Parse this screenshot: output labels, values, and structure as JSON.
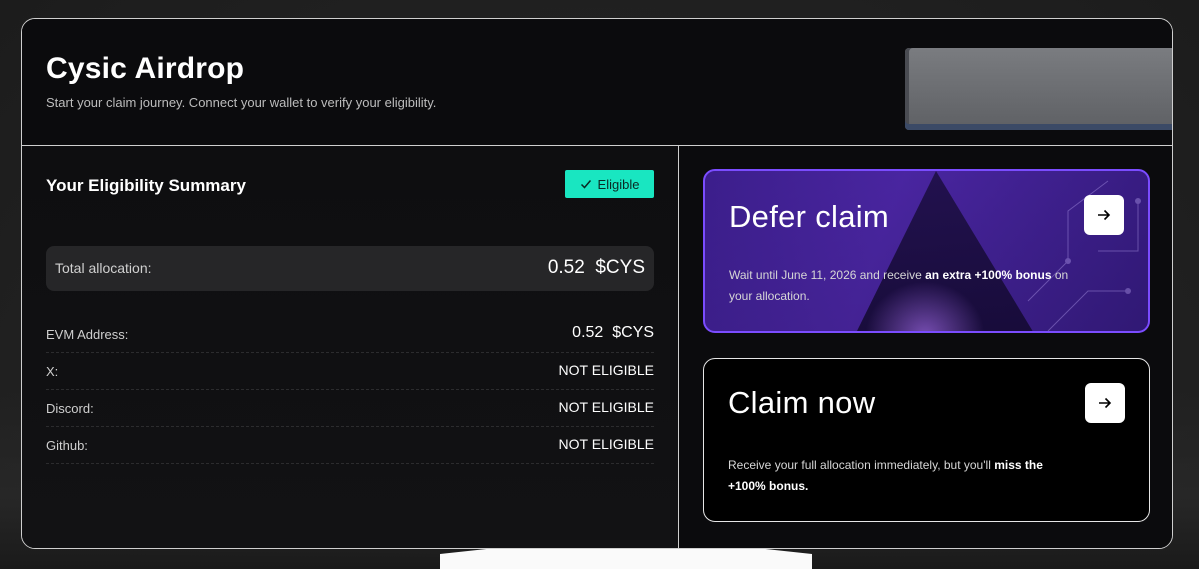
{
  "header": {
    "title": "Cysic Airdrop",
    "subtitle": "Start your claim journey. Connect your wallet to verify your eligibility."
  },
  "summary": {
    "title": "Your Eligibility Summary",
    "badge": "Eligible",
    "total_label": "Total allocation:",
    "total_value": "0.52  $CYS",
    "rows": [
      {
        "label": "EVM Address:",
        "value": "0.52  $CYS"
      },
      {
        "label": "X:",
        "value": "NOT ELIGIBLE"
      },
      {
        "label": "Discord:",
        "value": "NOT ELIGIBLE"
      },
      {
        "label": "Github:",
        "value": "NOT ELIGIBLE"
      }
    ]
  },
  "defer": {
    "title": "Defer claim",
    "desc_start": "Wait until June 11, 2026 and receive ",
    "desc_bold": "an extra +100% bonus",
    "desc_end": " on your allocation."
  },
  "claim": {
    "title": "Claim now",
    "desc_start": "Receive your full allocation immediately, but you'll ",
    "desc_bold": "miss the +100% bonus."
  },
  "colors": {
    "accent": "#19e6c1",
    "defer_border": "#7b4cff",
    "background": "#0c0c0e"
  },
  "icons": {
    "badge": "check-icon",
    "card_button": "arrow-right-icon"
  }
}
